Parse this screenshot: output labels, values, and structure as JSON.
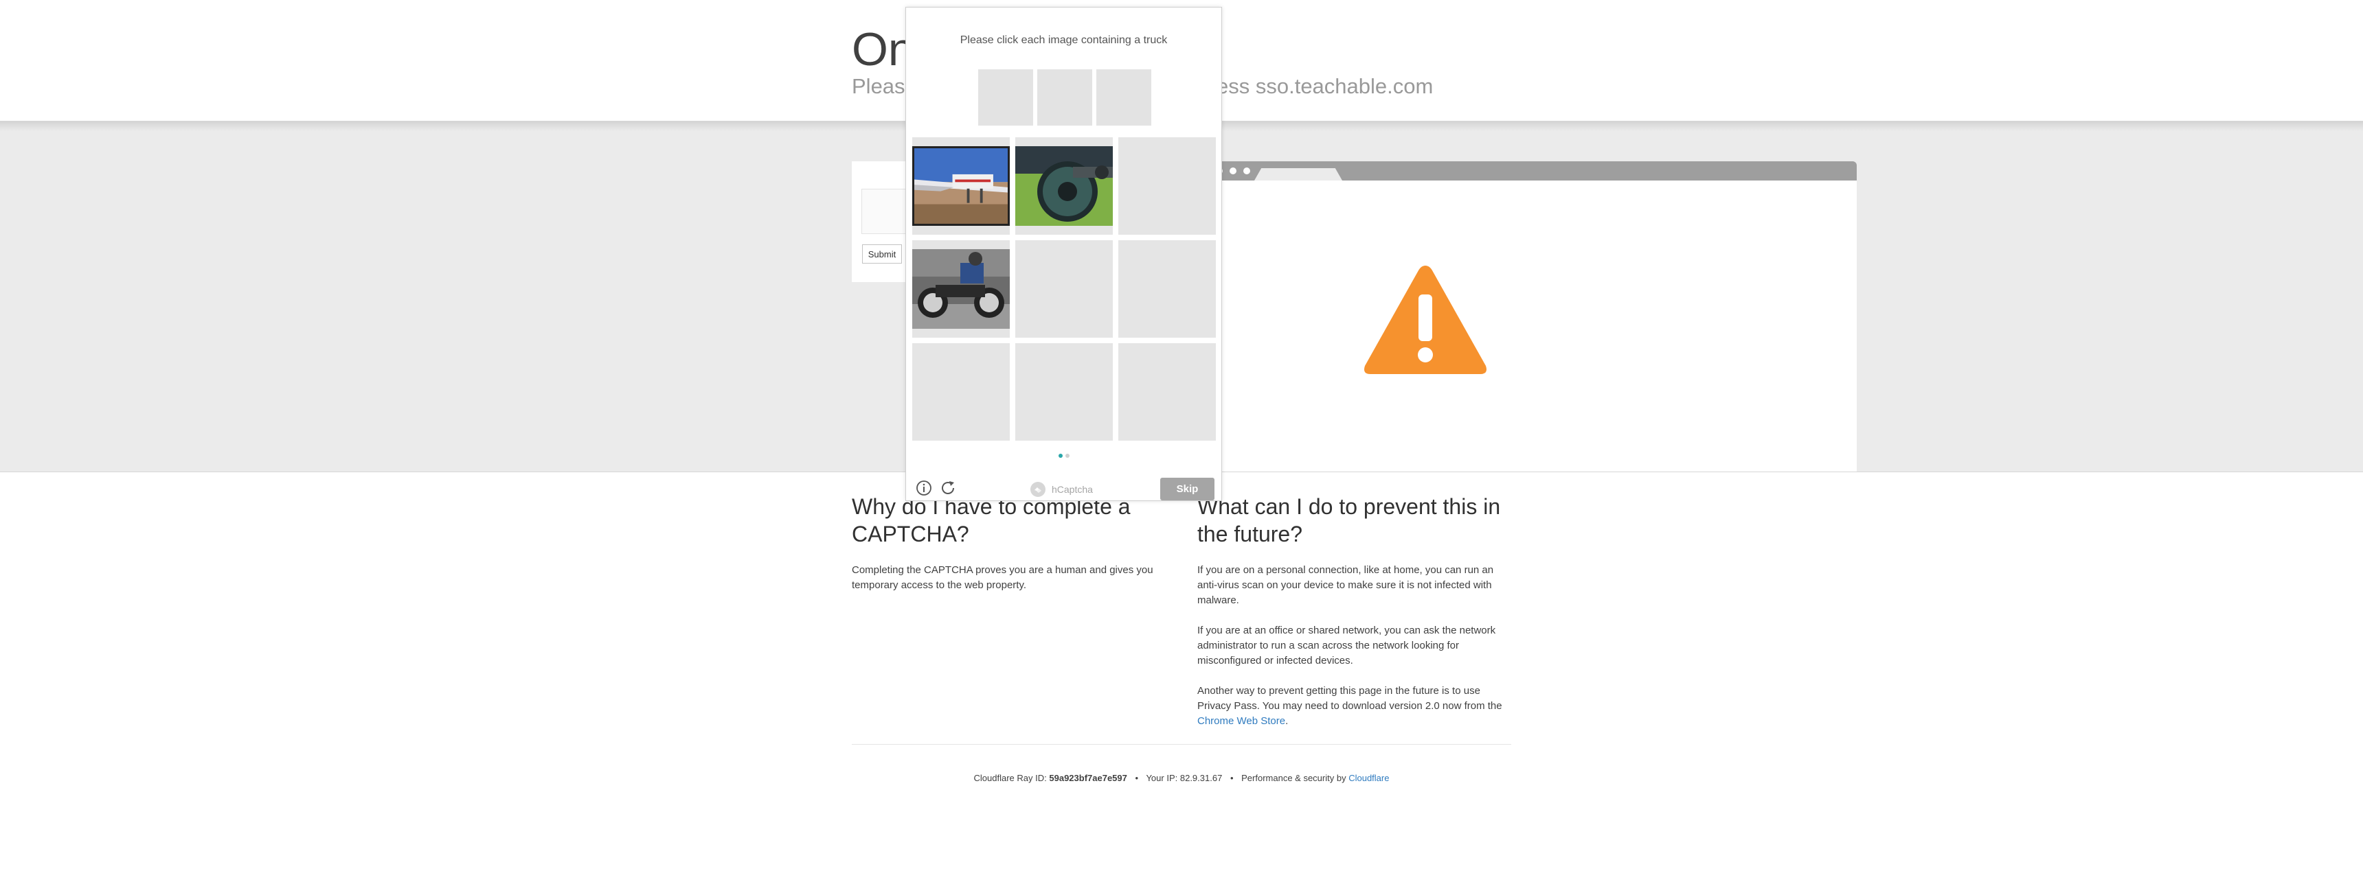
{
  "header": {
    "title": "On",
    "subtitle_left": "Please",
    "subtitle_right": "ccess sso.teachable.com"
  },
  "form": {
    "submit_label": "Submit"
  },
  "colors": {
    "band": "#ebebeb",
    "browser_bar": "#9e9e9e",
    "warning": "#f6922e",
    "link": "#2f7bbf",
    "skip_button": "#a5a5a5",
    "active_dot": "#2aa6a9"
  },
  "left_column": {
    "heading": "Why do I have to complete a CAPTCHA?",
    "body": "Completing the CAPTCHA proves you are a human and gives you temporary access to the web property."
  },
  "right_column": {
    "heading": "What can I do to prevent this in the future?",
    "p1": "If you are on a personal connection, like at home, you can run an anti-virus scan on your device to make sure it is not infected with malware.",
    "p2": "If you are at an office or shared network, you can ask the network administrator to run a scan across the network looking for misconfigured or infected devices.",
    "p3_before": "Another way to prevent getting this page in the future is to use Privacy Pass. You may need to download version 2.0 now from the ",
    "p3_link": "Chrome Web Store",
    "p3_after": "."
  },
  "footer": {
    "ray_label": "Cloudflare Ray ID:",
    "ray_id": "59a923bf7ae7e597",
    "ip_label": "Your IP:",
    "ip": "82.9.31.67",
    "perf_label": "Performance & security by",
    "perf_link": "Cloudflare",
    "bullet": "•"
  },
  "captcha": {
    "prompt": "Please click each image containing a truck",
    "brand": "hCaptcha",
    "skip_label": "Skip",
    "cells": [
      {
        "image": "airplane-photo",
        "selected": true
      },
      {
        "image": "motorcycle-wheel-photo",
        "selected": false
      },
      {
        "image": "",
        "selected": false
      },
      {
        "image": "motorcycle-rider-photo",
        "selected": false
      },
      {
        "image": "",
        "selected": false
      },
      {
        "image": "",
        "selected": false
      },
      {
        "image": "",
        "selected": false
      },
      {
        "image": "",
        "selected": false
      },
      {
        "image": "",
        "selected": false
      }
    ],
    "page_indicator": {
      "current": 1,
      "total": 2
    }
  }
}
